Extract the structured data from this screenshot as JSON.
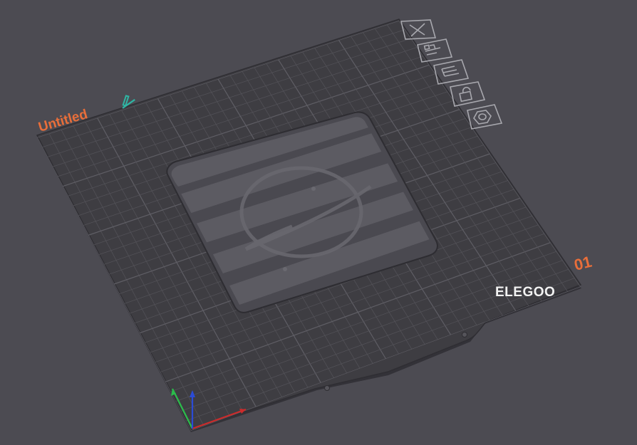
{
  "project": {
    "name": "Untitled",
    "edit_icon": "pencil-icon"
  },
  "plate": {
    "index_label": "01",
    "brand": "ELEGOO",
    "colors": {
      "background": "#4c4b52",
      "plate": "#3d3c41",
      "grid": "#56565c",
      "accent": "#e86e3a",
      "edit_icon": "#2fb5a3",
      "axis_x": "#cc2b2b",
      "axis_y": "#2bbb4b",
      "axis_z": "#2b4bd6"
    }
  },
  "plate_toolbar": [
    {
      "id": "close",
      "icon": "close-icon"
    },
    {
      "id": "arrange",
      "icon": "arrange-icon"
    },
    {
      "id": "plate-settings",
      "icon": "plate-settings-icon"
    },
    {
      "id": "lock",
      "icon": "unlock-icon"
    },
    {
      "id": "slice-settings",
      "icon": "hexagon-settings-icon"
    }
  ]
}
